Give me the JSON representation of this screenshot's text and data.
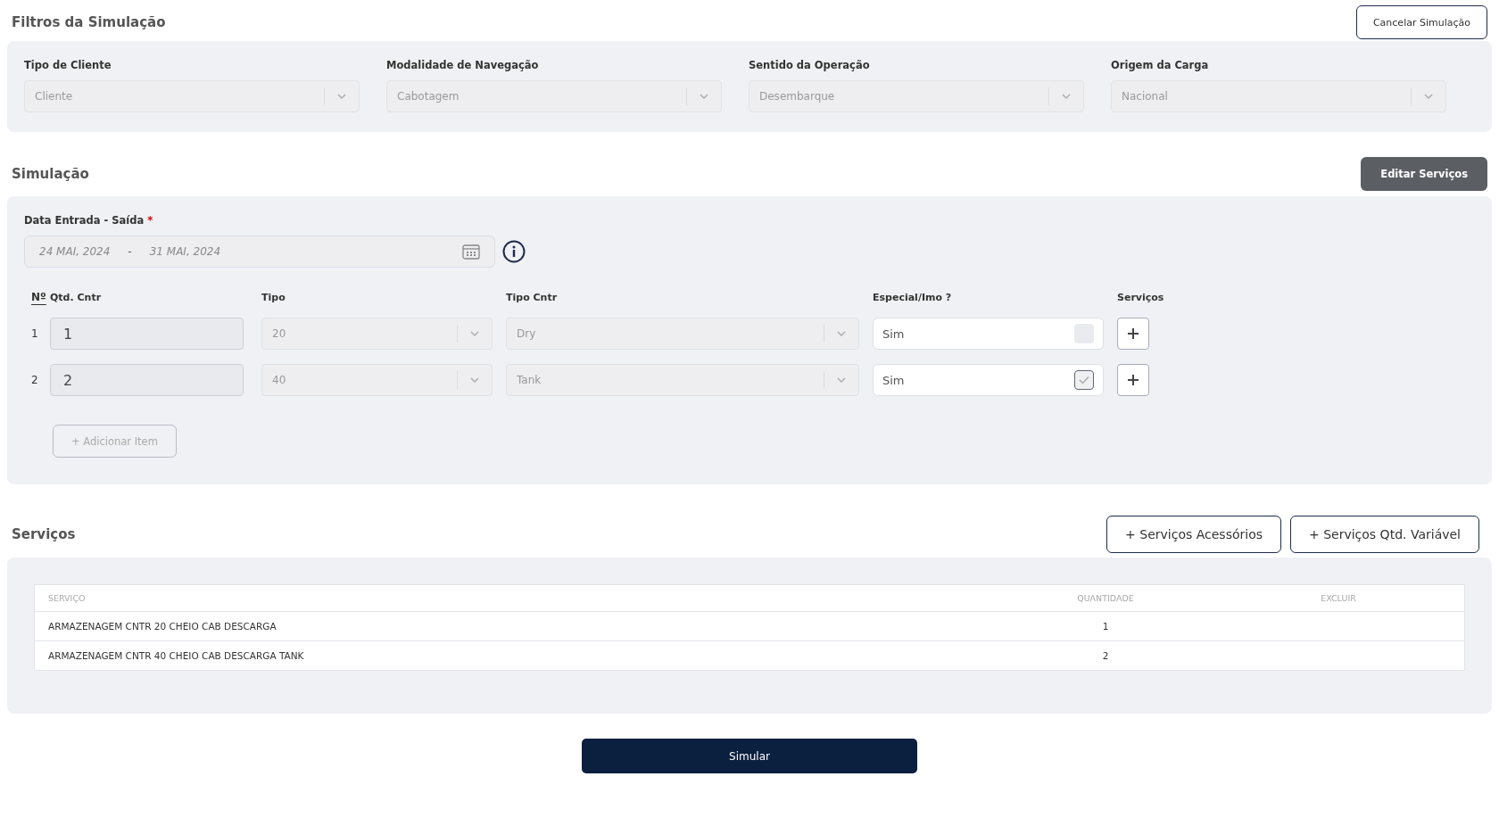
{
  "filters": {
    "title": "Filtros da Simulação",
    "cancel_button": "Cancelar Simulação",
    "fields": [
      {
        "label": "Tipo de Cliente",
        "value": "Cliente"
      },
      {
        "label": "Modalidade de Navegação",
        "value": "Cabotagem"
      },
      {
        "label": "Sentido da Operação",
        "value": "Desembarque"
      },
      {
        "label": "Origem da Carga",
        "value": "Nacional"
      }
    ]
  },
  "simulation": {
    "title": "Simulação",
    "edit_button": "Editar Serviços",
    "date_label": "Data Entrada - Saída",
    "required_mark": "*",
    "date_start": "24 MAI, 2024",
    "date_separator": "-",
    "date_end": "31 MAI, 2024",
    "columns": [
      "Nº",
      "Qtd. Cntr",
      "Tipo",
      "Tipo Cntr",
      "Especial/Imo ?",
      "Serviços"
    ],
    "items": [
      {
        "number": "1",
        "quantity": "1",
        "type": "20",
        "container_type": "Dry",
        "special": "Sim",
        "checked": false
      },
      {
        "number": "2",
        "quantity": "2",
        "type": "40",
        "container_type": "Tank",
        "special": "Sim",
        "checked": true
      }
    ],
    "add_button": "+ Adicionar Item"
  },
  "services": {
    "title": "Serviços",
    "buttons": [
      "+ Serviços Acessórios",
      "+ Serviços Qtd. Variável"
    ],
    "columns": [
      "SERVIÇO",
      "QUANTIDADE",
      "EXCLUIR"
    ],
    "rows": [
      {
        "service": "ARMAZENAGEM CNTR 20 CHEIO CAB DESCARGA",
        "quantity": "1"
      },
      {
        "service": "ARMAZENAGEM CNTR 40 CHEIO CAB DESCARGA TANK",
        "quantity": "2"
      }
    ]
  },
  "simulate_button": "Simular"
}
